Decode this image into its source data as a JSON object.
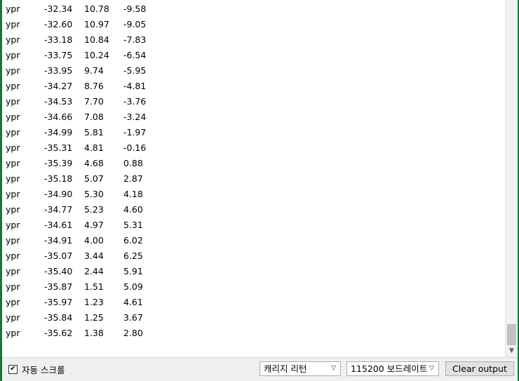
{
  "serial_output": {
    "rows": [
      {
        "label": "ypr",
        "yaw": "-32.34",
        "pitch": "10.78",
        "roll": "-9.58"
      },
      {
        "label": "ypr",
        "yaw": "-32.60",
        "pitch": "10.97",
        "roll": "-9.05"
      },
      {
        "label": "ypr",
        "yaw": "-33.18",
        "pitch": "10.84",
        "roll": "-7.83"
      },
      {
        "label": "ypr",
        "yaw": "-33.75",
        "pitch": "10.24",
        "roll": "-6.54"
      },
      {
        "label": "ypr",
        "yaw": "-33.95",
        "pitch": "9.74",
        "roll": "-5.95"
      },
      {
        "label": "ypr",
        "yaw": "-34.27",
        "pitch": "8.76",
        "roll": "-4.81"
      },
      {
        "label": "ypr",
        "yaw": "-34.53",
        "pitch": "7.70",
        "roll": "-3.76"
      },
      {
        "label": "ypr",
        "yaw": "-34.66",
        "pitch": "7.08",
        "roll": "-3.24"
      },
      {
        "label": "ypr",
        "yaw": "-34.99",
        "pitch": "5.81",
        "roll": "-1.97"
      },
      {
        "label": "ypr",
        "yaw": "-35.31",
        "pitch": "4.81",
        "roll": "-0.16"
      },
      {
        "label": "ypr",
        "yaw": "-35.39",
        "pitch": "4.68",
        "roll": "0.88"
      },
      {
        "label": "ypr",
        "yaw": "-35.18",
        "pitch": "5.07",
        "roll": "2.87"
      },
      {
        "label": "ypr",
        "yaw": "-34.90",
        "pitch": "5.30",
        "roll": "4.18"
      },
      {
        "label": "ypr",
        "yaw": "-34.77",
        "pitch": "5.23",
        "roll": "4.60"
      },
      {
        "label": "ypr",
        "yaw": "-34.61",
        "pitch": "4.97",
        "roll": "5.31"
      },
      {
        "label": "ypr",
        "yaw": "-34.91",
        "pitch": "4.00",
        "roll": "6.02"
      },
      {
        "label": "ypr",
        "yaw": "-35.07",
        "pitch": "3.44",
        "roll": "6.25"
      },
      {
        "label": "ypr",
        "yaw": "-35.40",
        "pitch": "2.44",
        "roll": "5.91"
      },
      {
        "label": "ypr",
        "yaw": "-35.87",
        "pitch": "1.51",
        "roll": "5.09"
      },
      {
        "label": "ypr",
        "yaw": "-35.97",
        "pitch": "1.23",
        "roll": "4.61"
      },
      {
        "label": "ypr",
        "yaw": "-35.84",
        "pitch": "1.25",
        "roll": "3.67"
      },
      {
        "label": "ypr",
        "yaw": "-35.62",
        "pitch": "1.38",
        "roll": "2.80"
      }
    ]
  },
  "footer": {
    "autoscroll_label": "자동 스크롤",
    "autoscroll_checked": true,
    "line_ending_selected": "캐리지 리턴",
    "baud_rate_selected": "115200 보드레이트",
    "clear_button_label": "Clear output"
  },
  "colors": {
    "window_border": "#0e7a3c",
    "panel_background": "#f0f0f0"
  }
}
